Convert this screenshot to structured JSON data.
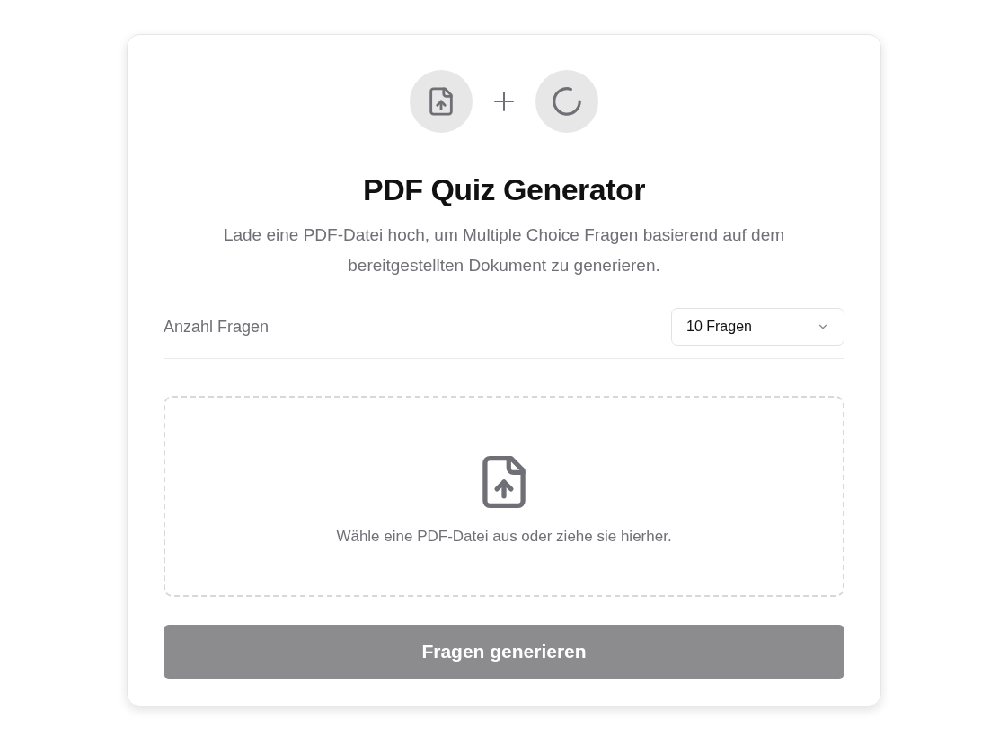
{
  "header": {
    "title": "PDF Quiz Generator",
    "description": "Lade eine PDF-Datei hoch, um Multiple Choice Fragen basierend auf dem bereitgestellten Dokument zu generieren."
  },
  "question_count": {
    "label": "Anzahl Fragen",
    "value": "10 Fragen"
  },
  "dropzone": {
    "text": "Wähle eine PDF-Datei aus oder ziehe sie hierher."
  },
  "generate_button": {
    "label": "Fragen generieren",
    "disabled": true
  }
}
